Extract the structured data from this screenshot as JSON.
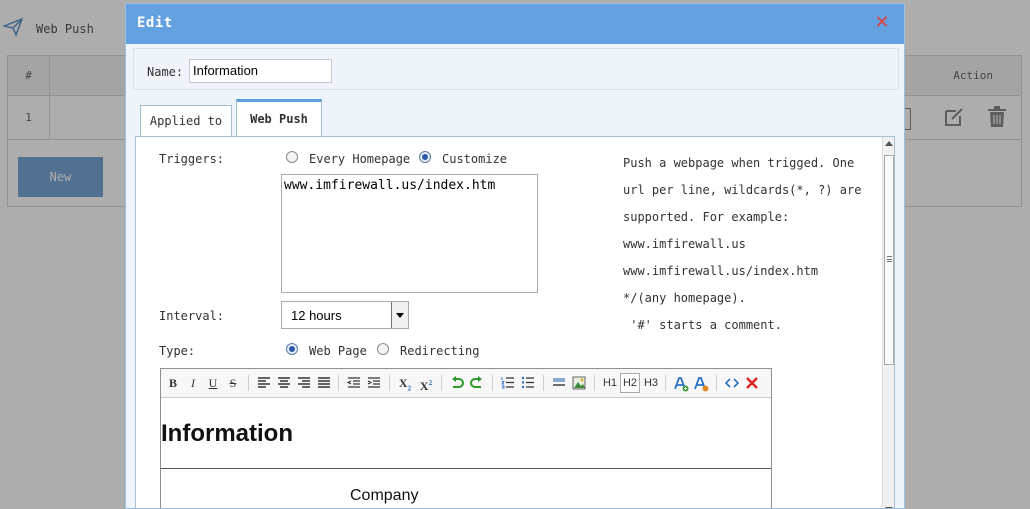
{
  "background": {
    "title": "Web Push",
    "table": {
      "headers": [
        "#",
        "Action"
      ],
      "row_number": "1"
    },
    "new_button": "New"
  },
  "dialog": {
    "title": "Edit",
    "name_label": "Name:",
    "name_value": "Information",
    "tabs": [
      "Applied to",
      "Web Push"
    ],
    "active_tab": "Web Push",
    "triggers": {
      "label": "Triggers:",
      "options": [
        "Every Homepage",
        "Customize"
      ],
      "selected": "Customize",
      "urls": "www.imfirewall.us/index.htm"
    },
    "help_lines": [
      "Push a webpage when trigged. One",
      "url per line, wildcards(*, ?) are",
      "supported. For example:",
      "www.imfirewall.us",
      "www.imfirewall.us/index.htm",
      "*/(any homepage).",
      " '#' starts a comment."
    ],
    "interval": {
      "label": "Interval:",
      "value": "12 hours"
    },
    "type": {
      "label": "Type:",
      "options": [
        "Web Page",
        "Redirecting"
      ],
      "selected": "Web Page"
    },
    "editor": {
      "toolbar": {
        "bold": "B",
        "italic": "I",
        "underline": "U",
        "strike": "S",
        "subscript": "X",
        "subscript_mark": "2",
        "superscript": "X",
        "superscript_mark": "2",
        "h1": "H1",
        "h2": "H2",
        "h3": "H3",
        "active_heading": "H2"
      },
      "heading": "Information",
      "body_text": "Company"
    }
  },
  "colors": {
    "title_bar": "#63a1e0",
    "close": "#e04040",
    "tab_accent": "#5ea0df"
  }
}
